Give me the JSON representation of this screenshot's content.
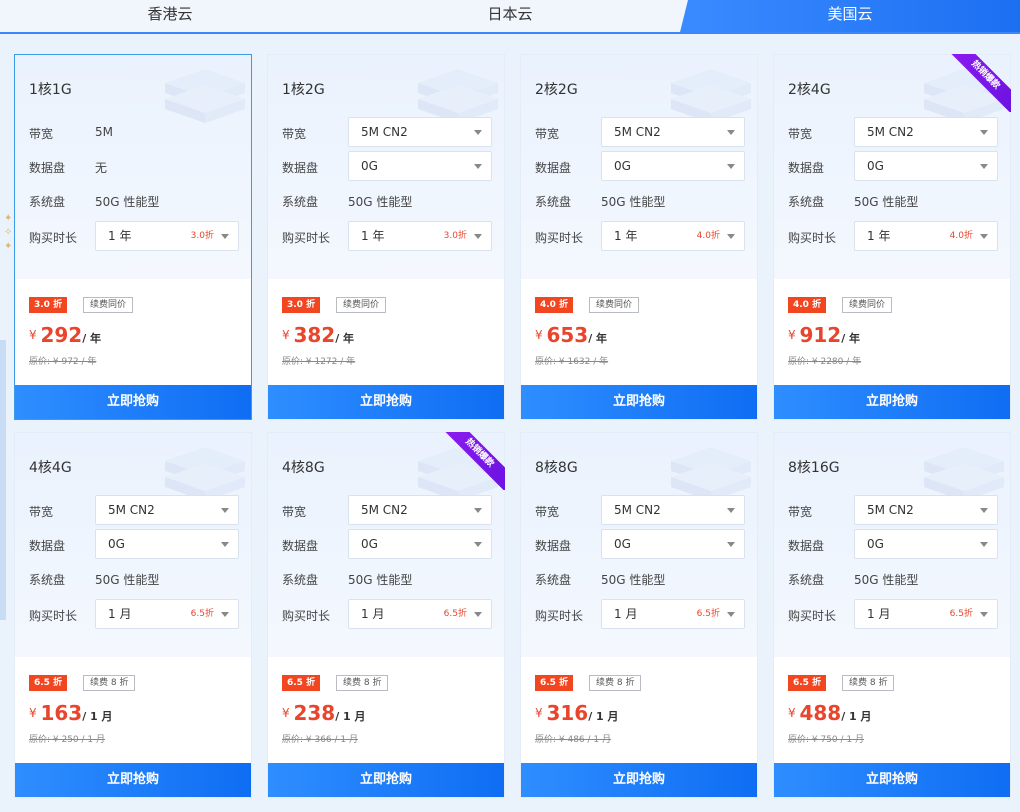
{
  "tabs": [
    "香港云",
    "日本云",
    "美国云"
  ],
  "active_tab": 2,
  "labels": {
    "bandwidth": "带宽",
    "disk": "数据盘",
    "sysdisk": "系统盘",
    "duration": "购买时长",
    "buy": "立即抢购",
    "hot": "热销爆款"
  },
  "cards": [
    {
      "title": "1核1G",
      "bandwidth": "5M",
      "disk": "无",
      "sysdisk": "50G 性能型",
      "duration": "1 年",
      "duration_disc": "3.0折",
      "badge": "3.0 折",
      "renew": "续费同价",
      "price": "292",
      "unit": "/ 年",
      "orig": "原价: ¥ 972 / 年",
      "hot": false,
      "active": true,
      "bw_select": false,
      "disk_select": false
    },
    {
      "title": "1核2G",
      "bandwidth": "5M CN2",
      "disk": "0G",
      "sysdisk": "50G 性能型",
      "duration": "1 年",
      "duration_disc": "3.0折",
      "badge": "3.0 折",
      "renew": "续费同价",
      "price": "382",
      "unit": "/ 年",
      "orig": "原价: ¥ 1272 / 年",
      "hot": false,
      "active": false,
      "bw_select": true,
      "disk_select": true
    },
    {
      "title": "2核2G",
      "bandwidth": "5M CN2",
      "disk": "0G",
      "sysdisk": "50G 性能型",
      "duration": "1 年",
      "duration_disc": "4.0折",
      "badge": "4.0 折",
      "renew": "续费同价",
      "price": "653",
      "unit": "/ 年",
      "orig": "原价: ¥ 1632 / 年",
      "hot": false,
      "active": false,
      "bw_select": true,
      "disk_select": true
    },
    {
      "title": "2核4G",
      "bandwidth": "5M CN2",
      "disk": "0G",
      "sysdisk": "50G 性能型",
      "duration": "1 年",
      "duration_disc": "4.0折",
      "badge": "4.0 折",
      "renew": "续费同价",
      "price": "912",
      "unit": "/ 年",
      "orig": "原价: ¥ 2280 / 年",
      "hot": true,
      "active": false,
      "bw_select": true,
      "disk_select": true
    },
    {
      "title": "4核4G",
      "bandwidth": "5M CN2",
      "disk": "0G",
      "sysdisk": "50G 性能型",
      "duration": "1 月",
      "duration_disc": "6.5折",
      "badge": "6.5 折",
      "renew": "续费 8 折",
      "price": "163",
      "unit": "/ 1 月",
      "orig": "原价: ¥ 250 / 1 月",
      "hot": false,
      "active": false,
      "bw_select": true,
      "disk_select": true
    },
    {
      "title": "4核8G",
      "bandwidth": "5M CN2",
      "disk": "0G",
      "sysdisk": "50G 性能型",
      "duration": "1 月",
      "duration_disc": "6.5折",
      "badge": "6.5 折",
      "renew": "续费 8 折",
      "price": "238",
      "unit": "/ 1 月",
      "orig": "原价: ¥ 366 / 1 月",
      "hot": true,
      "active": false,
      "bw_select": true,
      "disk_select": true
    },
    {
      "title": "8核8G",
      "bandwidth": "5M CN2",
      "disk": "0G",
      "sysdisk": "50G 性能型",
      "duration": "1 月",
      "duration_disc": "6.5折",
      "badge": "6.5 折",
      "renew": "续费 8 折",
      "price": "316",
      "unit": "/ 1 月",
      "orig": "原价: ¥ 486 / 1 月",
      "hot": false,
      "active": false,
      "bw_select": true,
      "disk_select": true
    },
    {
      "title": "8核16G",
      "bandwidth": "5M CN2",
      "disk": "0G",
      "sysdisk": "50G 性能型",
      "duration": "1 月",
      "duration_disc": "6.5折",
      "badge": "6.5 折",
      "renew": "续费 8 折",
      "price": "488",
      "unit": "/ 1 月",
      "orig": "原价: ¥ 750 / 1 月",
      "hot": false,
      "active": false,
      "bw_select": true,
      "disk_select": true
    }
  ]
}
